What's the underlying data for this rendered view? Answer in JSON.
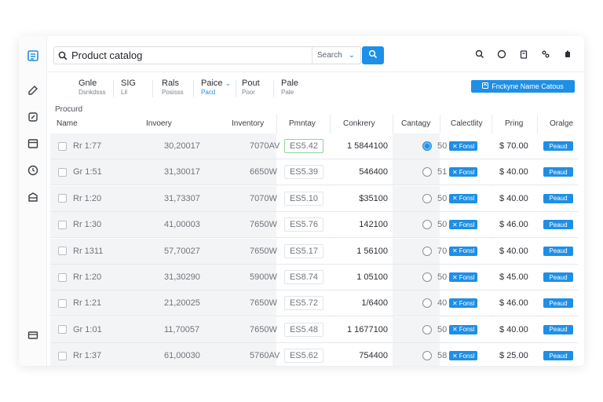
{
  "search": {
    "value": "Product catalog",
    "scope": "Search",
    "scope_caret": "⌄"
  },
  "filters": [
    {
      "label": "Gnle",
      "sub": "Dsnkdsss"
    },
    {
      "label": "SIG",
      "sub": "Lil"
    },
    {
      "label": "Rals",
      "sub": "Posisss"
    },
    {
      "label": "Paice",
      "caret": "⌄",
      "sub": "Pacd"
    },
    {
      "label": "Pout",
      "sub": "Poor"
    },
    {
      "label": "Pale",
      "sub": "Pale"
    }
  ],
  "primary_action": {
    "label": "Fnckyne Name Catous"
  },
  "group_label": "Procurd",
  "columns": [
    "Name",
    "Invoery",
    "Inventory",
    "Pmntay",
    "Conkrery",
    "Cantagy",
    "Calectlity",
    "Pring",
    "Oralge"
  ],
  "tag_label": "Fonsl",
  "tag2_label": "Peaud",
  "rows": [
    {
      "name": "Rr 1:77",
      "inv": "30,20017",
      "inv2": "7070AV",
      "price": "ES5.42",
      "price_hl": true,
      "conk": "1 5844100",
      "radio_on": true,
      "cat": "50",
      "pring": "$ 70.00"
    },
    {
      "name": "Gr 1:51",
      "inv": "31,30017",
      "inv2": "6650W",
      "price": "ES5.39",
      "price_hl": false,
      "conk": "546400",
      "radio_on": false,
      "cat": "51",
      "pring": "$ 40.00"
    },
    {
      "name": "Rr 1:20",
      "inv": "31,73307",
      "inv2": "7070W",
      "price": "ES5.10",
      "price_hl": false,
      "conk": "$35100",
      "radio_on": false,
      "cat": "50",
      "pring": "$ 40.00"
    },
    {
      "name": "Rr 1:30",
      "inv": "41,00003",
      "inv2": "7650W",
      "price": "ES5.76",
      "price_hl": false,
      "conk": "142100",
      "radio_on": false,
      "cat": "50",
      "pring": "$ 46.00"
    },
    {
      "name": "Rr 1311",
      "inv": "57,70027",
      "inv2": "7650W",
      "price": "ES5.17",
      "price_hl": false,
      "conk": "1 56100",
      "radio_on": false,
      "cat": "70",
      "pring": "$ 40.00"
    },
    {
      "name": "Rr 1:20",
      "inv": "31,30290",
      "inv2": "5900W",
      "price": "ES8.74",
      "price_hl": false,
      "conk": "1 05100",
      "radio_on": false,
      "cat": "50",
      "pring": "$ 45.00"
    },
    {
      "name": "Rr 1:21",
      "inv": "21,20025",
      "inv2": "7650W",
      "price": "ES5.72",
      "price_hl": false,
      "conk": "1/6400",
      "radio_on": false,
      "cat": "40",
      "pring": "$ 46.00"
    },
    {
      "name": "Gr 1:01",
      "inv": "11,70057",
      "inv2": "7650W",
      "price": "ES5.48",
      "price_hl": false,
      "conk": "1 1677100",
      "radio_on": false,
      "cat": "50",
      "pring": "$ 40.00"
    },
    {
      "name": "Rr 1:37",
      "inv": "61,00030",
      "inv2": "5760AV",
      "price": "ES5.62",
      "price_hl": false,
      "conk": "754400",
      "radio_on": false,
      "cat": "58",
      "pring": "$ 25.00"
    }
  ],
  "colors": {
    "accent": "#1e8fe6",
    "row_bg": "#f3f4f5",
    "highlight_border": "#8fd49b"
  }
}
